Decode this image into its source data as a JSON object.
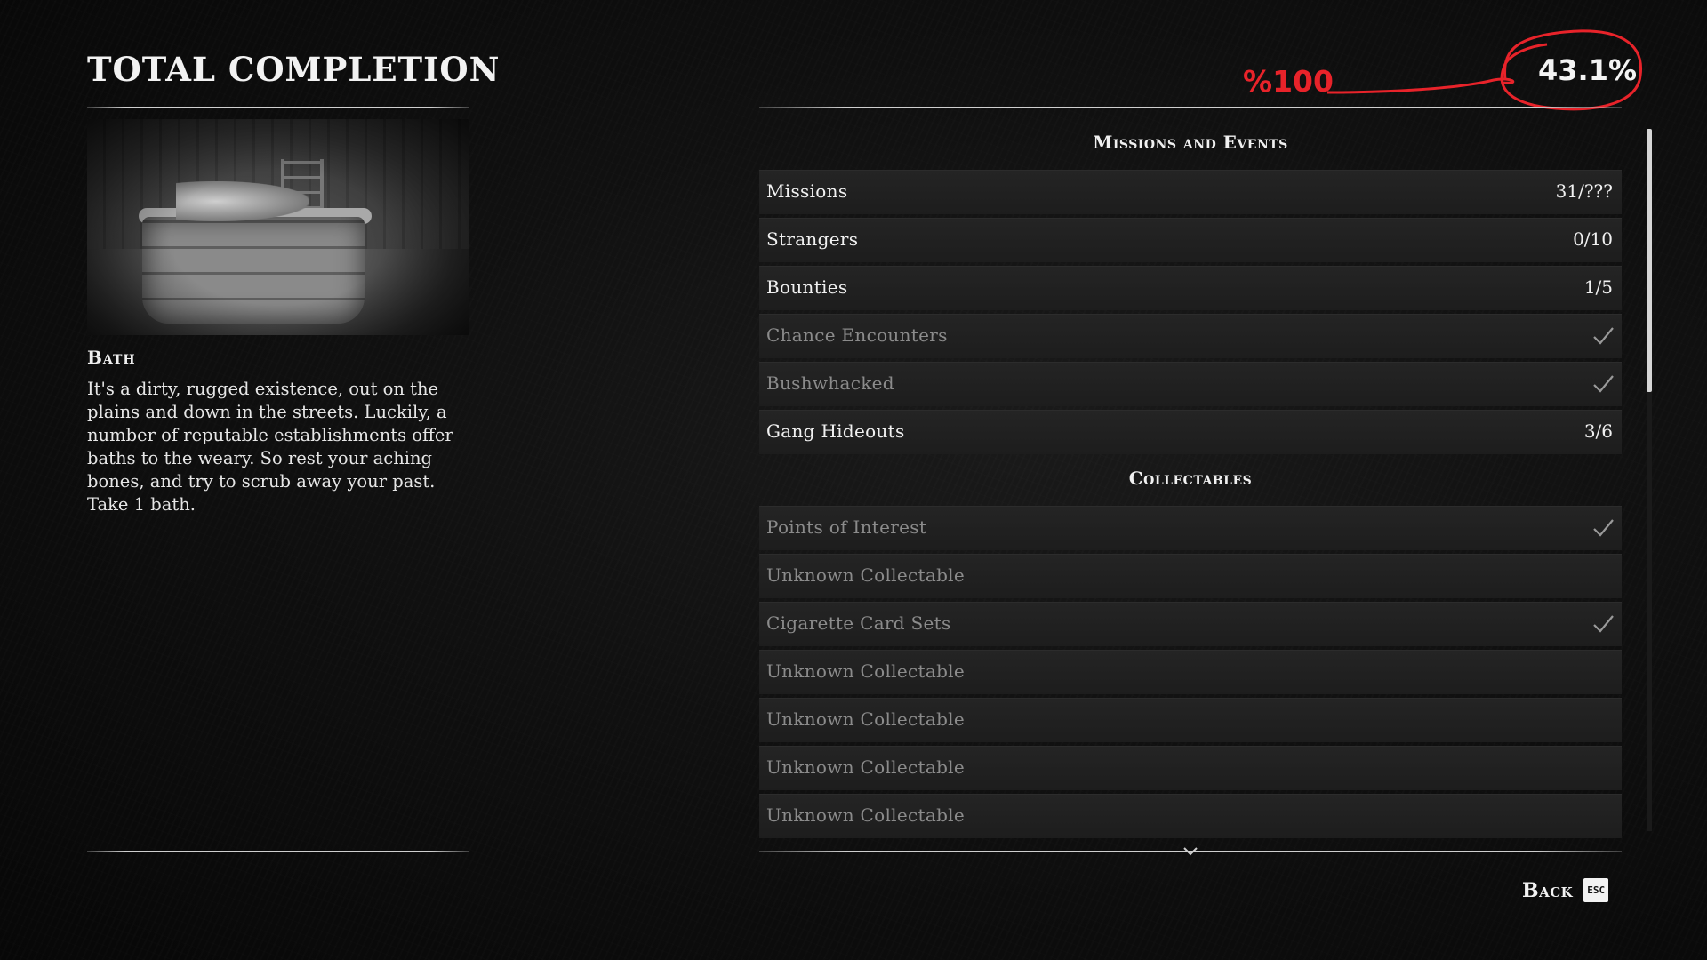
{
  "header": {
    "title": "TOTAL COMPLETION",
    "total_percent": "43.1%",
    "annotation": "%100"
  },
  "detail": {
    "title": "Bath",
    "description": "It's a dirty, rugged existence, out on the plains and down in the streets. Luckily, a number of reputable establishments offer baths to the weary. So rest your aching bones, and try to scrub away your past. Take 1 bath."
  },
  "sections": {
    "missions_header": "Missions and Events",
    "collectables_header": "Collectables"
  },
  "missions_rows": [
    {
      "label": "Missions",
      "value": "31/???",
      "state": "active"
    },
    {
      "label": "Strangers",
      "value": "0/10",
      "state": "active"
    },
    {
      "label": "Bounties",
      "value": "1/5",
      "state": "active"
    },
    {
      "label": "Chance Encounters",
      "value": "",
      "state": "completed"
    },
    {
      "label": "Bushwhacked",
      "value": "",
      "state": "completed"
    },
    {
      "label": "Gang Hideouts",
      "value": "3/6",
      "state": "active"
    }
  ],
  "collectables_rows": [
    {
      "label": "Points of Interest",
      "value": "",
      "state": "completed"
    },
    {
      "label": "Unknown Collectable",
      "value": "",
      "state": "unknown"
    },
    {
      "label": "Cigarette Card Sets",
      "value": "",
      "state": "completed"
    },
    {
      "label": "Unknown Collectable",
      "value": "",
      "state": "unknown"
    },
    {
      "label": "Unknown Collectable",
      "value": "",
      "state": "unknown"
    },
    {
      "label": "Unknown Collectable",
      "value": "",
      "state": "unknown"
    },
    {
      "label": "Unknown Collectable",
      "value": "",
      "state": "unknown"
    }
  ],
  "footer": {
    "back_label": "Back",
    "back_key": "ESC"
  },
  "colors": {
    "annotation_red": "#e8232a",
    "text_primary": "#f1f1f1",
    "text_dim": "#8b8b8b",
    "row_bg": "#222222"
  },
  "icons": {
    "completed": "checkmark-icon",
    "scroll_more": "chevron-down-icon"
  }
}
